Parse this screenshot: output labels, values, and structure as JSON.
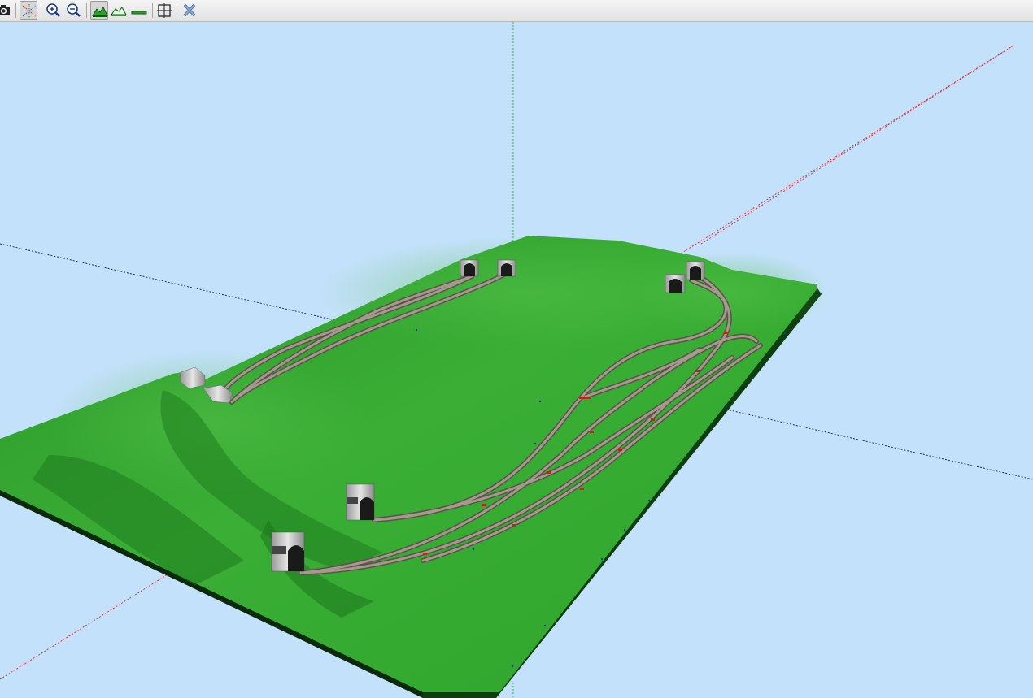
{
  "toolbar": {
    "buttons": [
      {
        "name": "screenshot",
        "icon": "camera-icon",
        "pressed": false
      },
      {
        "name": "toggle-axes",
        "icon": "axes-icon",
        "pressed": true
      },
      {
        "name": "zoom-in",
        "icon": "zoom-in-icon",
        "pressed": false
      },
      {
        "name": "zoom-out",
        "icon": "zoom-out-icon",
        "pressed": false
      },
      {
        "name": "terrain-solid",
        "icon": "terrain-solid-icon",
        "pressed": true
      },
      {
        "name": "terrain-outline",
        "icon": "terrain-outline-icon",
        "pressed": false
      },
      {
        "name": "terrain-flat",
        "icon": "terrain-flat-icon",
        "pressed": false
      },
      {
        "name": "fit-view",
        "icon": "fit-view-icon",
        "pressed": false
      },
      {
        "name": "close-view",
        "icon": "close-icon",
        "pressed": false
      }
    ]
  },
  "scene": {
    "background_color": "#c4e1fb",
    "terrain_color": "#2aa32a",
    "terrain_dark_color": "#0f4f10",
    "track_color": "#8d8075",
    "axis_x_color": "#e0303a",
    "axis_y_color": "#2fbf3a",
    "axis_z_color": "#1a2a7a",
    "tunnel_portal_count": 8,
    "visible_axes": [
      "x-axis",
      "y-axis",
      "z-axis"
    ]
  }
}
